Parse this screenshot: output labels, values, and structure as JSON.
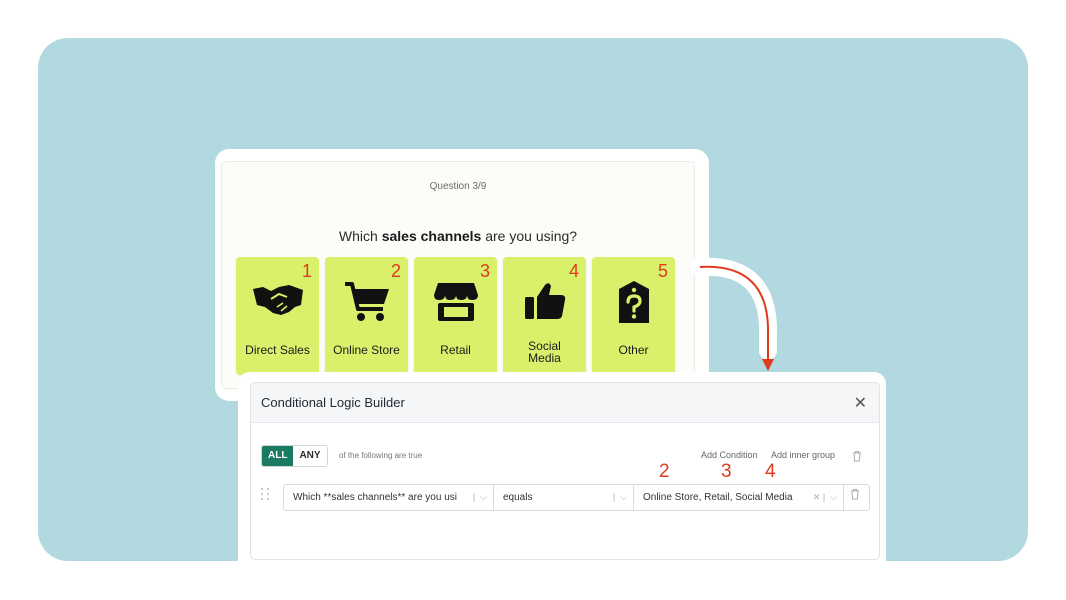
{
  "question": {
    "counter": "Question 3/9",
    "title_pre": "Which ",
    "title_bold": "sales channels",
    "title_post": " are you using?",
    "options": [
      {
        "number": "1",
        "label": "Direct Sales",
        "icon": "handshake-icon"
      },
      {
        "number": "2",
        "label": "Online Store",
        "icon": "shopping-cart-icon"
      },
      {
        "number": "3",
        "label": "Retail",
        "icon": "store-icon"
      },
      {
        "number": "4",
        "label": "Social\nMedia",
        "icon": "thumbs-up-icon"
      },
      {
        "number": "5",
        "label": "Other",
        "icon": "question-tag-icon"
      }
    ],
    "tile_color": "#d8f06a",
    "number_color": "#e03a1e"
  },
  "logic_builder": {
    "title": "Conditional Logic Builder",
    "close_label": "✕",
    "match_options": [
      "ALL",
      "ANY"
    ],
    "match_selected": "ALL",
    "match_suffix": "of the following are true",
    "add_condition": "Add Condition",
    "add_inner_group": "Add inner group",
    "condition": {
      "question": "Which **sales channels** are you usi",
      "operator": "equals",
      "value": "Online Store, Retail, Social Media"
    },
    "annotations": [
      "2",
      "3",
      "4"
    ],
    "accent": "#1a7a62"
  },
  "background_color": "#b2d8e0"
}
